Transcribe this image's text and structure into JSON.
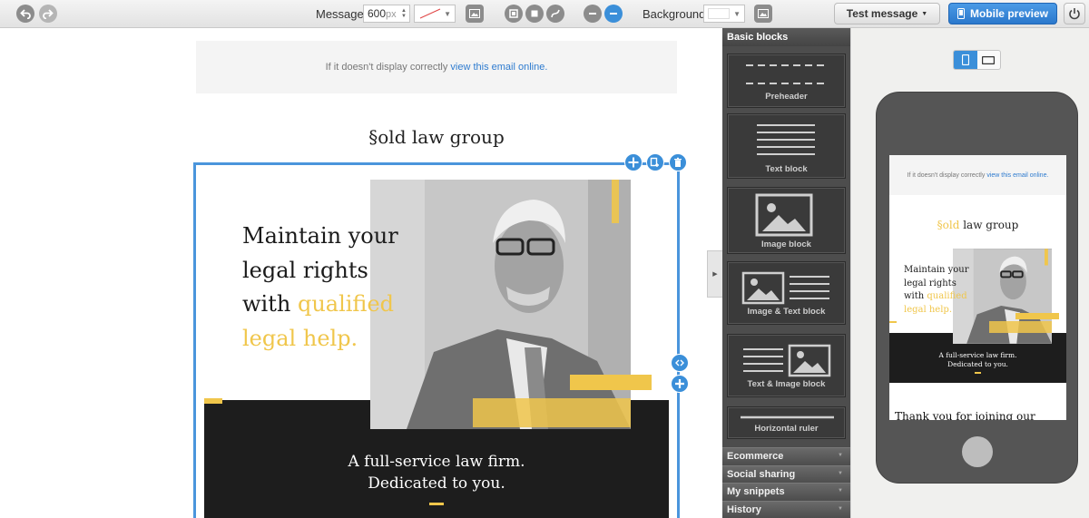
{
  "toolbar": {
    "message_label": "Message",
    "width_value": "600",
    "width_unit": "px",
    "background_label": "Background",
    "test_message_label": "Test message",
    "mobile_preview_label": "Mobile preview"
  },
  "email": {
    "preheader_text": "If it doesn't display correctly",
    "preheader_link": "view this email online.",
    "logo_mark": "§old",
    "logo_text": " law group",
    "headline_line1": "Maintain your",
    "headline_line2": "legal rights",
    "headline_line3_plain": "with ",
    "headline_line3_gold": "qualified",
    "headline_line4_gold": "legal help.",
    "tagline_line1": "A full-service law firm.",
    "tagline_line2": "Dedicated to you.",
    "thanks_text": "Thank you for joining our"
  },
  "panel": {
    "header": "Basic blocks",
    "blocks": [
      "Preheader",
      "Text block",
      "Image block",
      "Image & Text block",
      "Text & Image block",
      "Horizontal ruler"
    ],
    "sections": [
      "Ecommerce",
      "Social sharing",
      "My snippets",
      "History"
    ]
  },
  "colors": {
    "accent": "#3b8fd9",
    "gold": "#f0c64b",
    "dark_band": "#1d1d1d",
    "panel_bg": "#4d4d4d"
  }
}
